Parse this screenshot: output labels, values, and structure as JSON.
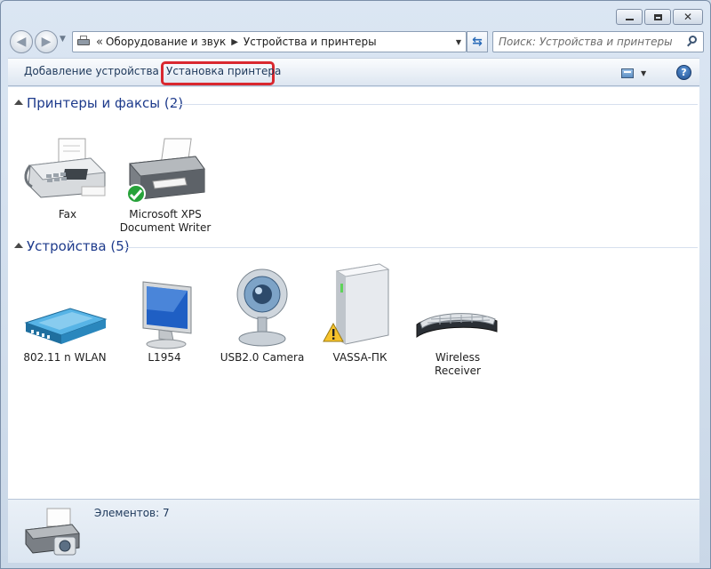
{
  "window": {
    "controls": {
      "minimize_icon": "minimize-icon",
      "maximize_icon": "maximize-icon",
      "close_icon": "close-icon"
    }
  },
  "navigation": {
    "address_overflow": "«",
    "breadcrumbs": [
      "Оборудование и звук",
      "Устройства и принтеры"
    ],
    "search_placeholder": "Поиск: Устройства и принтеры"
  },
  "toolbar": {
    "add_device_label": "Добавление устройства",
    "install_printer_label": "Установка принтера",
    "highlight_color": "#d9282f",
    "help_label": "?"
  },
  "groups": [
    {
      "title": "Принтеры и факсы (2)",
      "items": [
        {
          "label_lines": [
            "Fax"
          ],
          "icon": "fax-icon"
        },
        {
          "label_lines": [
            "Microsoft XPS",
            "Document Writer"
          ],
          "icon": "printer-icon",
          "badge": "default-checkmark-icon"
        }
      ]
    },
    {
      "title": "Устройства (5)",
      "items": [
        {
          "label_lines": [
            "802.11 n WLAN"
          ],
          "icon": "router-icon"
        },
        {
          "label_lines": [
            "L1954"
          ],
          "icon": "monitor-icon"
        },
        {
          "label_lines": [
            "USB2.0 Camera"
          ],
          "icon": "webcam-icon"
        },
        {
          "label_lines": [
            "VASSA-ПК"
          ],
          "icon": "computer-icon",
          "badge": "warning-icon"
        },
        {
          "label_lines": [
            "Wireless Receiver"
          ],
          "icon": "keyboard-icon"
        }
      ]
    }
  ],
  "status": {
    "items_count_text": "Элементов: 7"
  },
  "colors": {
    "group_title": "#1e3b8c",
    "command_text": "#1e395b",
    "content_bg": "#ffffff"
  }
}
